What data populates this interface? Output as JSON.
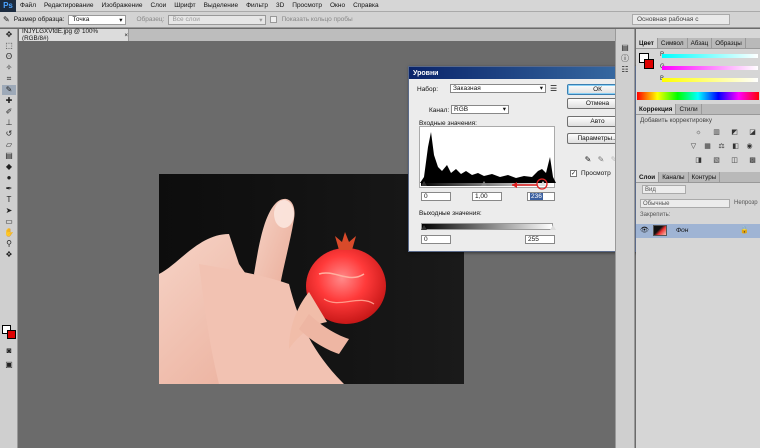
{
  "app": {
    "logo": "Ps",
    "menu": [
      "Файл",
      "Редактирование",
      "Изображение",
      "Слои",
      "Шрифт",
      "Выделение",
      "Фильтр",
      "3D",
      "Просмотр",
      "Окно",
      "Справка"
    ]
  },
  "options_bar": {
    "sample_size_label": "Размер образца:",
    "sample_size_value": "Точка",
    "sample_label": "Образец:",
    "sample_value": "Все слои",
    "show_ring_label": "Показать кольцо пробы",
    "workspace": "Основная рабочая с"
  },
  "document": {
    "tab_title": "INJYLGXVfdE.jpg @ 100% (RGB/8#)",
    "close": "×"
  },
  "levels_dialog": {
    "title": "Уровни",
    "close": "×",
    "preset_label": "Набор:",
    "preset_value": "Заказная",
    "channel_label": "Канал:",
    "channel_value": "RGB",
    "input_levels_label": "Входные значения:",
    "input_black": "0",
    "input_gamma": "1,00",
    "input_white": "236",
    "output_levels_label": "Выходные значения:",
    "output_black": "0",
    "output_white": "255",
    "buttons": {
      "ok": "ОК",
      "cancel": "Отмена",
      "auto": "Авто",
      "options": "Параметры..."
    },
    "preview_label": "Просмотр",
    "preview_checked": true
  },
  "color_panel": {
    "tabs": [
      "Цвет",
      "Символ",
      "Абзац",
      "Образцы"
    ],
    "channels": [
      "R",
      "G",
      "B"
    ]
  },
  "adjustments_panel": {
    "tabs": [
      "Коррекция",
      "Стили"
    ],
    "hint": "Добавить корректировку"
  },
  "layers_panel": {
    "tabs": [
      "Слои",
      "Каналы",
      "Контуры"
    ],
    "kind_filter": "Вид",
    "blend_mode": "Обычные",
    "opacity_label": "Непрозр",
    "lock_label": "Закрепить:",
    "layers": [
      {
        "name": "Фон"
      }
    ]
  },
  "colors": {
    "accent_red": "#e02020",
    "dialog_title": "#0a246a",
    "layer_selected": "#9fb4d4"
  }
}
